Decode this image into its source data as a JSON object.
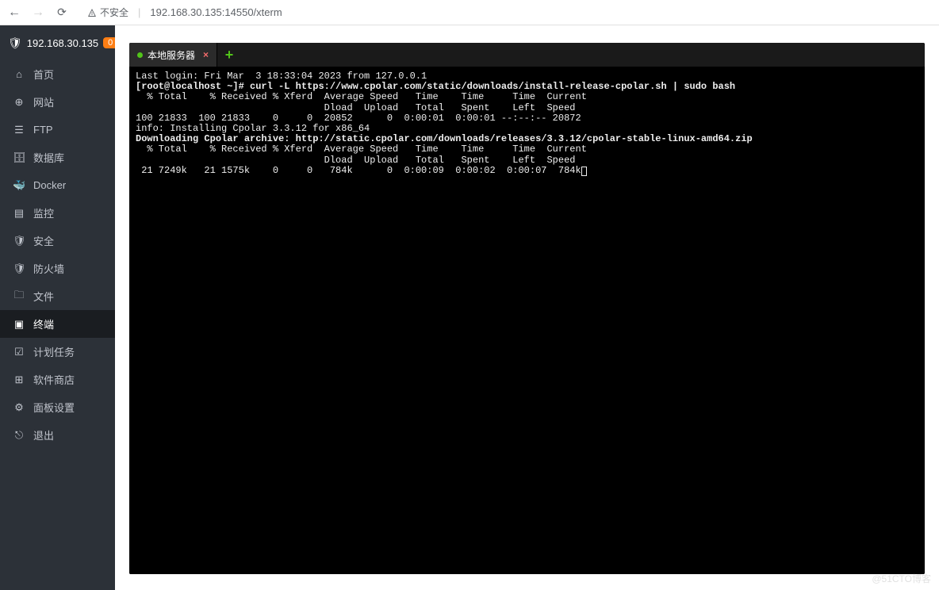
{
  "browser": {
    "security_text": "不安全",
    "url_host": "192.168.30.135",
    "url_port": ":14550",
    "url_path": "/xterm"
  },
  "sidebar": {
    "ip": "192.168.30.135",
    "badge": "0",
    "items": [
      {
        "icon": "home",
        "label": "首页"
      },
      {
        "icon": "globe",
        "label": "网站"
      },
      {
        "icon": "server",
        "label": "FTP"
      },
      {
        "icon": "db",
        "label": "数据库"
      },
      {
        "icon": "docker",
        "label": "Docker"
      },
      {
        "icon": "chart",
        "label": "监控"
      },
      {
        "icon": "shield",
        "label": "安全"
      },
      {
        "icon": "fire",
        "label": "防火墙"
      },
      {
        "icon": "folder",
        "label": "文件"
      },
      {
        "icon": "terminal",
        "label": "终端"
      },
      {
        "icon": "calendar",
        "label": "计划任务"
      },
      {
        "icon": "grid",
        "label": "软件商店"
      },
      {
        "icon": "gear",
        "label": "面板设置"
      },
      {
        "icon": "exit",
        "label": "退出"
      }
    ]
  },
  "tab": {
    "label": "本地服务器"
  },
  "terminal": {
    "lines": [
      "Last login: Fri Mar  3 18:33:04 2023 from 127.0.0.1",
      "[root@localhost ~]# curl -L https://www.cpolar.com/static/downloads/install-release-cpolar.sh | sudo bash",
      "  % Total    % Received % Xferd  Average Speed   Time    Time     Time  Current",
      "                                 Dload  Upload   Total   Spent    Left  Speed",
      "100 21833  100 21833    0     0  20852      0  0:00:01  0:00:01 --:--:-- 20872",
      "info: Installing Cpolar 3.3.12 for x86_64",
      "Downloading Cpolar archive: http://static.cpolar.com/downloads/releases/3.3.12/cpolar-stable-linux-amd64.zip",
      "  % Total    % Received % Xferd  Average Speed   Time    Time     Time  Current",
      "                                 Dload  Upload   Total   Spent    Left  Speed",
      " 21 7249k   21 1575k    0     0   784k      0  0:00:09  0:00:02  0:00:07  784k"
    ]
  },
  "watermark": "@51CTO博客"
}
